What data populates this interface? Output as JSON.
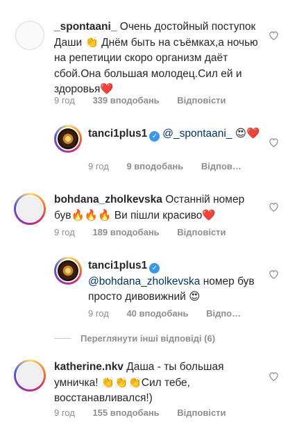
{
  "comments": [
    {
      "username": "_spontaani_",
      "text": "Очень достойный поступок Даши 👏 Днём быть на съёмках,а ночью на репетиции скоро организм даёт сбой.Она большая молодец.Сил ей и здоровья❤️",
      "time": "9 год",
      "likes": "339 вподобань",
      "reply": "Відповісти"
    },
    {
      "username": "tanci1plus1",
      "mention": "@_spontaani_",
      "text": "😍❤️",
      "time": "9 год",
      "likes": "9 вподобань",
      "reply": "Відпов…"
    },
    {
      "username": "bohdana_zholkevska",
      "text": "Останній номер був🔥🔥🔥 Ви пішли красиво❤️",
      "time": "9 год",
      "likes": "189 вподобань",
      "reply": "Відповісти"
    },
    {
      "username": "tanci1plus1",
      "mention": "@bohdana_zholkevska",
      "text": "номер був просто дивовижний 😍",
      "time": "9 год",
      "likes": "40 вподобань",
      "reply": "Відпо…"
    },
    {
      "username": "katherine.nkv",
      "text": "Даша - ты большая умничка! 👏👏👏Сил тебе, восстанавливался!)",
      "time": "9 год",
      "likes": "155 вподобань",
      "reply": "Відповісти"
    }
  ],
  "view_replies": "Переглянути інші відповіді (6)"
}
